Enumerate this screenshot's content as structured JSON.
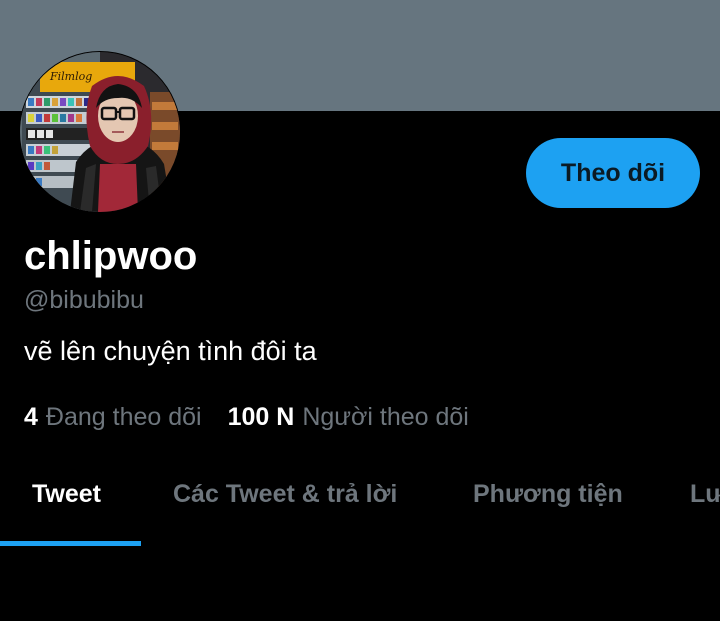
{
  "profile": {
    "display_name": "chlipwoo",
    "handle": "@bibubibu",
    "bio": "vẽ lên chuyện tình đôi ta",
    "banner_color": "#66757f",
    "avatar_sign_text": "Filmlog"
  },
  "actions": {
    "follow_label": "Theo dõi",
    "accent_color": "#1da1f2"
  },
  "stats": {
    "following_count": "4",
    "following_label": "Đang theo dõi",
    "followers_count": "100 N",
    "followers_label": "Người theo dõi"
  },
  "tabs": [
    {
      "label": "Tweet",
      "active": true
    },
    {
      "label": "Các Tweet & trả lời",
      "active": false
    },
    {
      "label": "Phương tiện",
      "active": false
    },
    {
      "label": "Lượt thích",
      "active": false
    }
  ]
}
